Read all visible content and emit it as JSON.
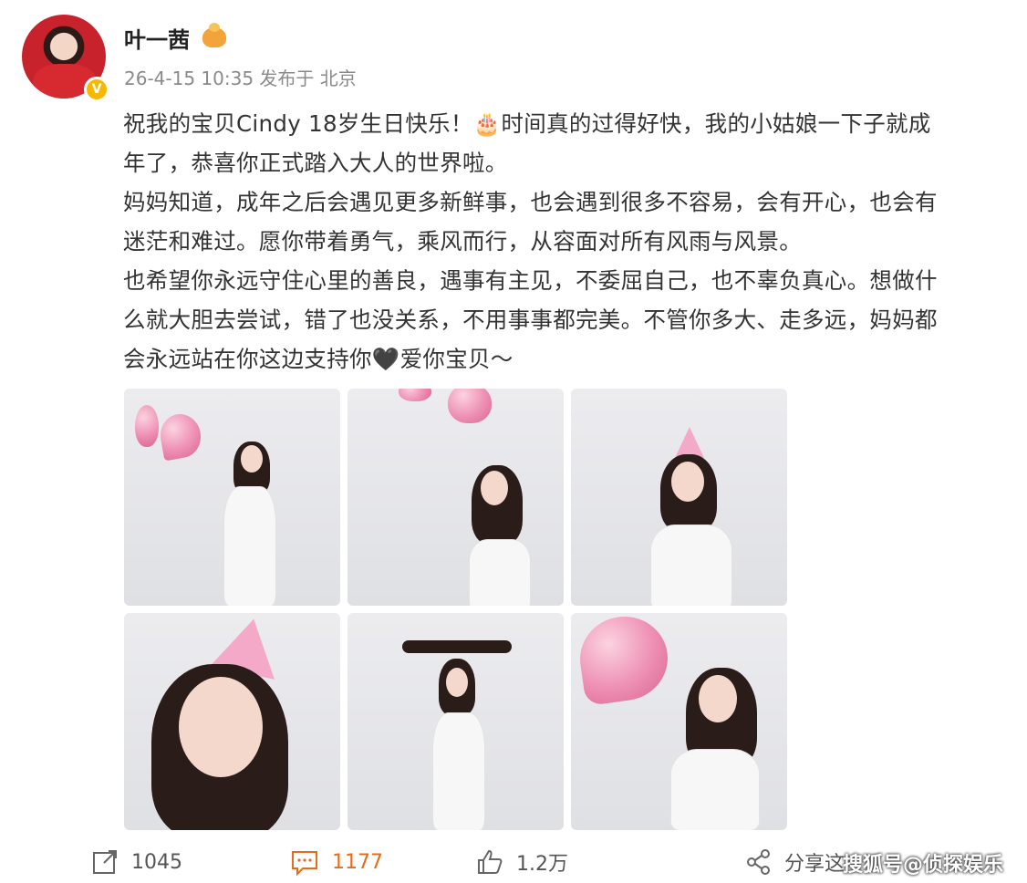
{
  "header": {
    "username": "叶一茜",
    "meta": "26-4-15 10:35 发布于 北京",
    "avatar_badge": "V"
  },
  "post": {
    "lines": [
      "祝我的宝贝Cindy 18岁生日快乐！🎂时间真的过得好快，我的小姑娘一下子就成",
      "年了，恭喜你正式踏入大人的世界啦。",
      "妈妈知道，成年之后会遇见更多新鲜事，也会遇到很多不容易，会有开心，也会有",
      "迷茫和难过。愿你带着勇气，乘风而行，从容面对所有风雨与风景。",
      "也希望你永远守住心里的善良，遇事有主见，不委屈自己，也不辜负真心。想做什",
      "么就大胆去尝试，错了也没关系，不用事事都完美。不管你多大、走多远，妈妈都",
      "会永远站在你这边支持你🖤爱你宝贝～"
    ]
  },
  "footer": {
    "repost_count": "1045",
    "comment_count": "1177",
    "like_count": "1.2万",
    "share_label": "分享这",
    "watermark": "搜狐号@侦探娱乐"
  },
  "colors": {
    "comment_accent": "#e86b1c",
    "balloon_pink": "#ee8fb3",
    "badge_gold": "#f6b800"
  }
}
